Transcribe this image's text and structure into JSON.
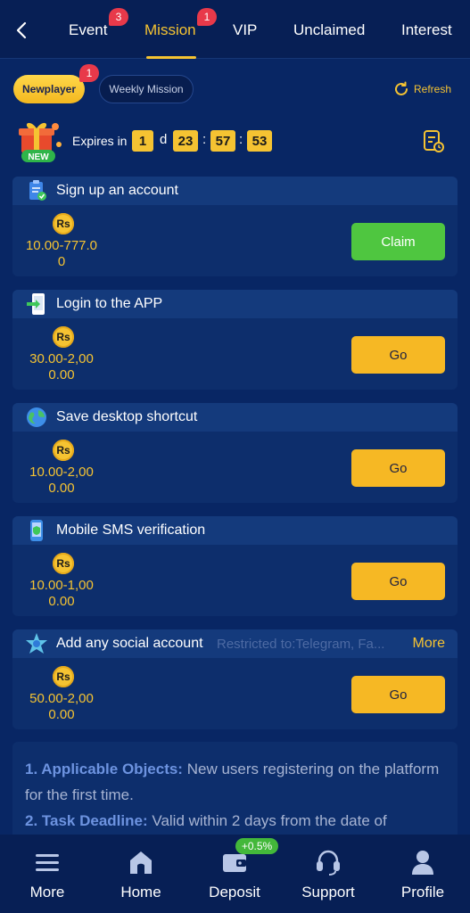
{
  "header": {
    "back_icon": "chevron-left-icon",
    "tabs": [
      {
        "label": "Event",
        "badge": "3"
      },
      {
        "label": "Mission",
        "badge": "1",
        "active": true
      },
      {
        "label": "VIP"
      },
      {
        "label": "Unclaimed"
      },
      {
        "label": "Interest"
      }
    ]
  },
  "subtabs": {
    "items": [
      {
        "label": "Newplayer",
        "badge": "1",
        "active": true
      },
      {
        "label": "Weekly Mission"
      }
    ],
    "refresh_label": "Refresh"
  },
  "expiry": {
    "label": "Expires in",
    "days": "1",
    "day_unit": "d",
    "hours": "23",
    "minutes": "57",
    "seconds": "53",
    "gift_badge": "NEW"
  },
  "missions": [
    {
      "title": "Sign up an account",
      "currency": "Rs",
      "amount_line1": "10.00-777.0",
      "amount_line2": "0",
      "action": "Claim",
      "icon": "clipboard-check-icon"
    },
    {
      "title": "Login to the APP",
      "currency": "Rs",
      "amount_line1": "30.00-2,00",
      "amount_line2": "0.00",
      "action": "Go",
      "icon": "phone-login-icon"
    },
    {
      "title": "Save desktop shortcut",
      "currency": "Rs",
      "amount_line1": "10.00-2,00",
      "amount_line2": "0.00",
      "action": "Go",
      "icon": "globe-icon"
    },
    {
      "title": "Mobile SMS verification",
      "currency": "Rs",
      "amount_line1": "10.00-1,00",
      "amount_line2": "0.00",
      "action": "Go",
      "icon": "mobile-sms-icon"
    },
    {
      "title": "Add any social account",
      "restriction": "Restricted to:Telegram, Fa...",
      "more": "More",
      "currency": "Rs",
      "amount_line1": "50.00-2,00",
      "amount_line2": "0.00",
      "action": "Go",
      "icon": "social-star-icon"
    }
  ],
  "rules": {
    "r1_label": "1. Applicable Objects:",
    "r1_text": " New users registering on the platform for the first time.",
    "r2_label": "2. Task Deadline:",
    "r2_text": " Valid within 2 days from the date of"
  },
  "bottom_nav": {
    "items": [
      {
        "label": "More",
        "icon": "menu-icon"
      },
      {
        "label": "Home",
        "icon": "home-icon"
      },
      {
        "label": "Deposit",
        "icon": "wallet-icon",
        "badge": "+0.5%"
      },
      {
        "label": "Support",
        "icon": "headset-icon"
      },
      {
        "label": "Profile",
        "icon": "user-icon"
      }
    ]
  },
  "colors": {
    "background": "#082664",
    "accent": "#f5c332",
    "claim": "#4fc640",
    "go": "#f6b824",
    "badge": "#e8394a"
  }
}
